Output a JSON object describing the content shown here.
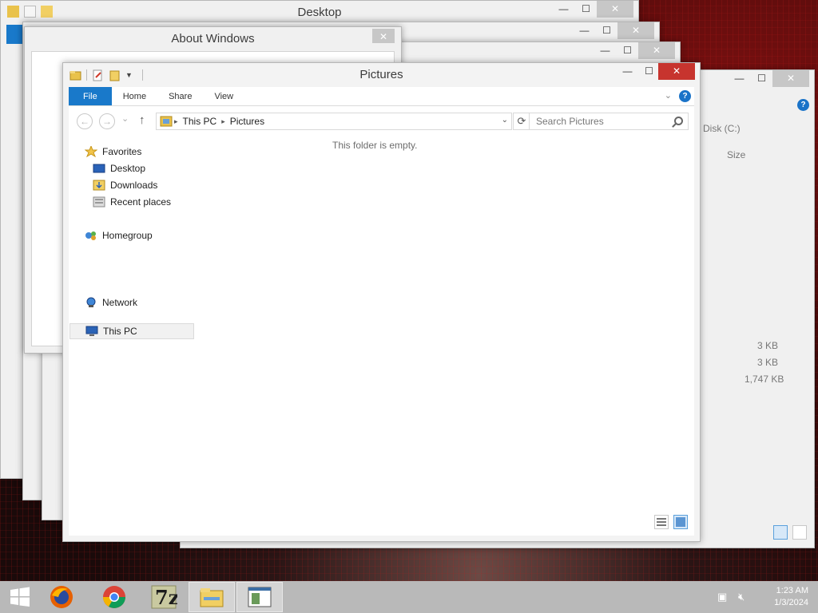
{
  "back_windows": {
    "desktop_title": "Desktop",
    "about_title": "About Windows",
    "right_fragments": {
      "drive_label": "Disk (C:)",
      "size_header": "Size",
      "sizes": [
        "3 KB",
        "3 KB",
        "1,747 KB"
      ]
    }
  },
  "window": {
    "title": "Pictures",
    "minimize_glyph": "—",
    "maximize_glyph": "☐",
    "close_glyph": "✕",
    "ribbon": {
      "tabs": [
        "File",
        "Home",
        "Share",
        "View"
      ],
      "help": "?"
    },
    "nav": {
      "back_glyph": "←",
      "forward_glyph": "→",
      "recent_glyph": "⌄",
      "up_glyph": "↑"
    },
    "address": {
      "segments": [
        "This PC",
        "Pictures"
      ],
      "sep_glyph": "▸",
      "dropdown_glyph": "⌄",
      "refresh_glyph": "⟳"
    },
    "search": {
      "placeholder": "Search Pictures"
    },
    "navpane": {
      "favorites": "Favorites",
      "favorites_items": [
        "Desktop",
        "Downloads",
        "Recent places"
      ],
      "homegroup": "Homegroup",
      "this_pc": "This PC",
      "network": "Network"
    },
    "empty_message": "This folder is empty."
  },
  "taskbar": {
    "clock_time": "1:23 AM",
    "clock_date": "1/3/2024",
    "apps": [
      "start",
      "firefox",
      "chrome",
      "7zip",
      "file-explorer",
      "notepad-window"
    ]
  },
  "colors": {
    "file_tab": "#1979ca",
    "close_active": "#c7342e",
    "taskbar": "#b9b9b9"
  }
}
